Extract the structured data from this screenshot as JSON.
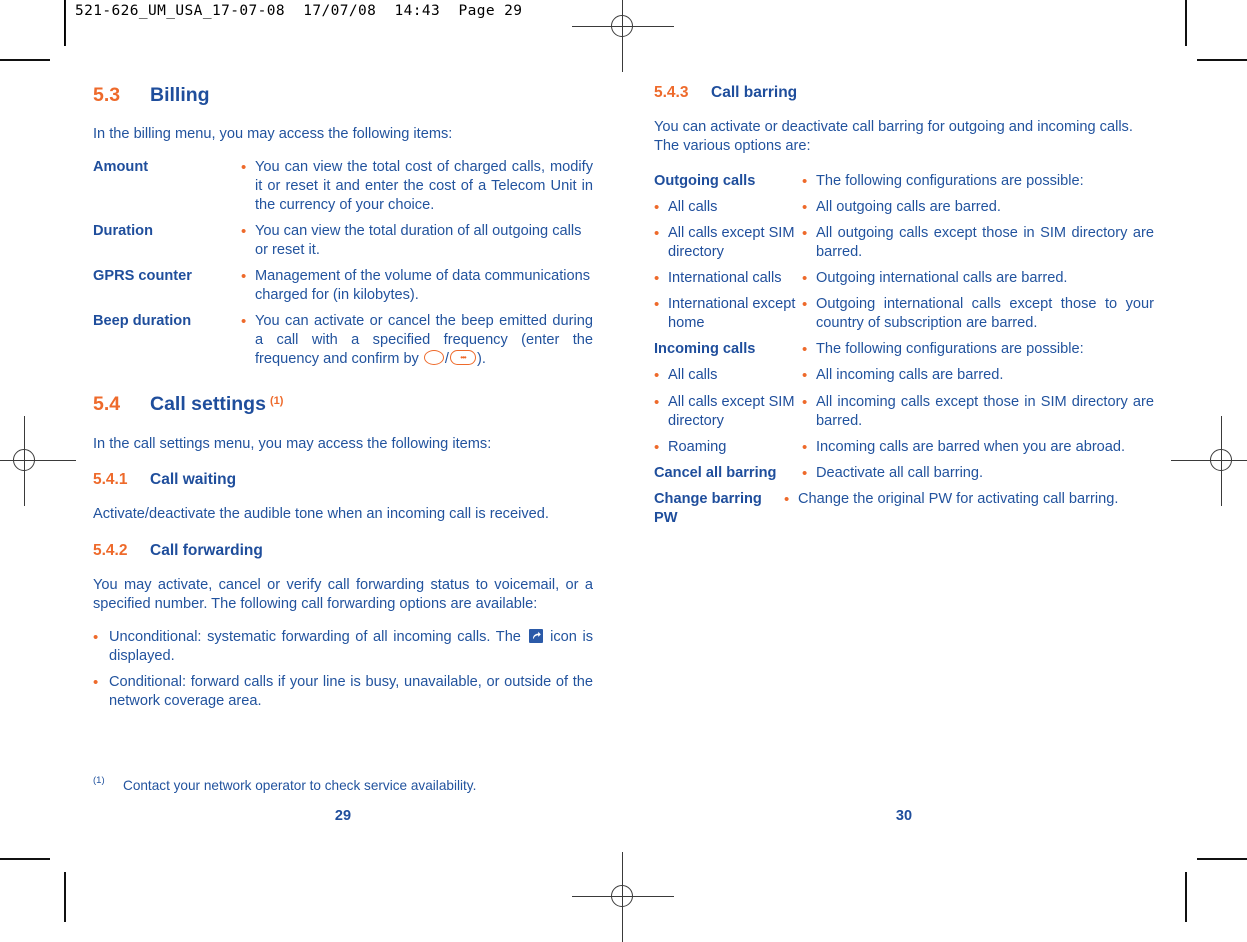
{
  "slug": {
    "text": "521-626_UM_USA_17-07-08  17/07/08  14:43  Page 29"
  },
  "colors": {
    "accent_orange": "#ee6a2b",
    "heading_blue": "#1f4e9c",
    "body_blue": "#22539e"
  },
  "left_page": {
    "folio": "29",
    "section_billing": {
      "number": "5.3",
      "title": "Billing",
      "intro": "In the billing menu, you may access the following items:",
      "rows": [
        {
          "term": "Amount",
          "bullet": "•",
          "desc": "You can view the total cost of charged calls, modify it or reset it and enter the cost of a Telecom Unit in the currency of your choice."
        },
        {
          "term": "Duration",
          "bullet": "•",
          "desc": "You can view the total duration of all outgoing calls or reset it."
        },
        {
          "term": "GPRS counter",
          "bullet": "•",
          "desc": "Management of the volume of data communications charged for (in kilobytes)."
        },
        {
          "term": "Beep duration",
          "bullet": "•",
          "desc_part1": "You can activate or cancel the beep emitted during a call with a specified frequency (enter the frequency and confirm by ",
          "desc_sep": "/",
          "desc_part2": ")."
        }
      ]
    },
    "section_call_settings": {
      "number": "5.4",
      "title": "Call settings",
      "footnote_marker": "(1)",
      "intro": "In the call settings menu, you may access the following items:",
      "sub_call_waiting": {
        "number": "5.4.1",
        "title": "Call waiting",
        "body": "Activate/deactivate the audible tone when an incoming call is received."
      },
      "sub_call_forwarding": {
        "number": "5.4.2",
        "title": "Call forwarding",
        "body": "You may activate, cancel or verify call forwarding status to voicemail, or a specified number. The following call forwarding options are available:",
        "bullets": [
          {
            "marker": "•",
            "part1": "Unconditional: systematic forwarding of all incoming calls. The ",
            "icon": "call-forward-icon",
            "part2": " icon is displayed."
          },
          {
            "marker": "•",
            "text": "Conditional: forward calls if your line is busy, unavailable, or outside of the network coverage area."
          }
        ]
      }
    },
    "footnote": {
      "marker": "(1)",
      "text": "Contact your network operator to check service availability."
    }
  },
  "right_page": {
    "folio": "30",
    "section_call_barring": {
      "number": "5.4.3",
      "title": "Call barring",
      "intro": "You can activate or deactivate call barring for outgoing and incoming calls. The various options are:",
      "rows": [
        {
          "term": "Outgoing calls",
          "term_bold": true,
          "term_bullet": "",
          "bullet": "•",
          "desc": "The following configurations are possible:"
        },
        {
          "term": "All calls",
          "term_bold": false,
          "term_bullet": "•",
          "bullet": "•",
          "desc": "All outgoing calls are barred."
        },
        {
          "term": "All calls except SIM directory",
          "term_bold": false,
          "term_bullet": "•",
          "bullet": "•",
          "desc": "All outgoing calls except those in SIM directory are barred."
        },
        {
          "term": "International calls",
          "term_bold": false,
          "term_bullet": "•",
          "bullet": "•",
          "desc": "Outgoing international calls are barred."
        },
        {
          "term": "International except home",
          "term_bold": false,
          "term_bullet": "•",
          "bullet": "•",
          "desc": "Outgoing international calls except those to your country of subscription are barred."
        },
        {
          "term": "Incoming calls",
          "term_bold": true,
          "term_bullet": "",
          "bullet": "•",
          "desc": "The following configurations are possible:"
        },
        {
          "term": "All calls",
          "term_bold": false,
          "term_bullet": "•",
          "bullet": "•",
          "desc": "All incoming calls are barred."
        },
        {
          "term": "All calls except SIM directory",
          "term_bold": false,
          "term_bullet": "•",
          "bullet": "•",
          "desc": "All incoming calls except those in SIM directory are barred."
        },
        {
          "term": "Roaming",
          "term_bold": false,
          "term_bullet": "•",
          "bullet": "•",
          "desc": "Incoming calls are barred when you are abroad."
        },
        {
          "term": "Cancel all barring",
          "term_bold": true,
          "term_bullet": "",
          "bullet": "•",
          "desc": "Deactivate all call barring."
        },
        {
          "term": "Change barring PW",
          "term_bold": true,
          "term_bullet": "",
          "bullet": "•",
          "desc": "Change the original PW for activating call barring."
        }
      ]
    }
  }
}
